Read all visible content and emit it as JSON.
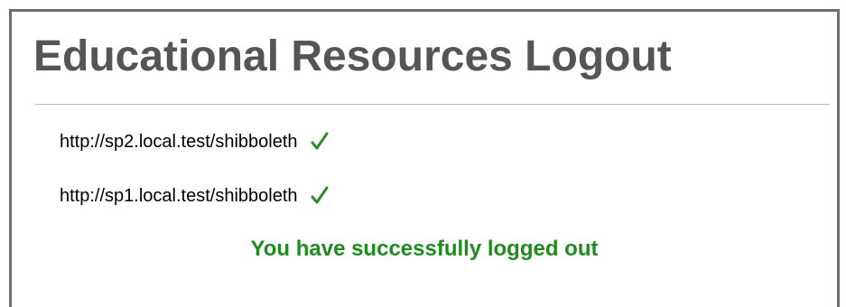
{
  "page": {
    "title": "Educational Resources Logout"
  },
  "service_providers": [
    {
      "url": "http://sp2.local.test/shibboleth",
      "status_icon": "check-icon"
    },
    {
      "url": "http://sp1.local.test/shibboleth",
      "status_icon": "check-icon"
    }
  ],
  "status": {
    "message": "You have successfully logged out"
  },
  "colors": {
    "title": "#555555",
    "success": "#1e8c1e",
    "check": "#2e8b2e",
    "frame_border": "#6e6e6e"
  }
}
